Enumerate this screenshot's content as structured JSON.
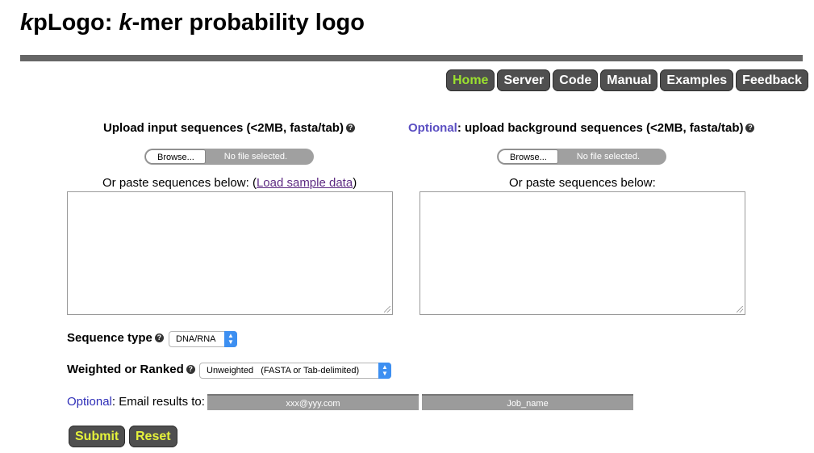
{
  "header": {
    "title_k1": "k",
    "title_mid": "pLogo: ",
    "title_k2": "k",
    "title_rest": "-mer probability logo"
  },
  "nav": [
    "Home",
    "Server",
    "Code",
    "Manual",
    "Examples",
    "Feedback"
  ],
  "active_nav": "Home",
  "left": {
    "heading": "Upload input sequences (<2MB, fasta/tab)",
    "browse_label": "Browse...",
    "no_file": "No file selected.",
    "paste_prefix": "Or paste sequences below: (",
    "sample_link": "Load sample data",
    "paste_suffix": ")"
  },
  "right": {
    "optional": "Optional",
    "heading": ": upload background sequences (<2MB, fasta/tab)",
    "browse_label": "Browse...",
    "no_file": "No file selected.",
    "paste": "Or paste sequences below:"
  },
  "help_glyph": "?",
  "sequence_type": {
    "label": "Sequence type",
    "value": "DNA/RNA"
  },
  "weighted": {
    "label": "Weighted or Ranked",
    "value": "Unweighted   (FASTA or Tab-delimited)"
  },
  "email": {
    "optional": "Optional",
    "label": ": Email results to:",
    "email_placeholder": "xxx@yyy.com",
    "job_placeholder": "Job_name"
  },
  "actions": {
    "submit": "Submit",
    "reset": "Reset"
  },
  "colors": {
    "nav_bg": "#4f4f4f",
    "active_nav": "#9be02f",
    "action_text": "#e5f23b",
    "optional": "#5b4fc2"
  }
}
